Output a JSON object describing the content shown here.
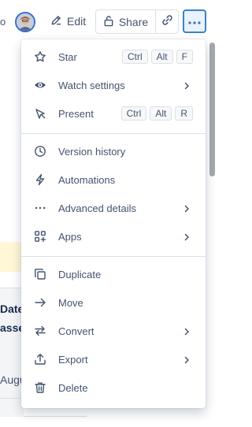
{
  "toolbar": {
    "cut_text": "o",
    "edit_label": "Edit",
    "share_label": "Share"
  },
  "background": {
    "table_header_line1": "Date",
    "table_header_line2": "asse",
    "table_cell": "Augu"
  },
  "menu": {
    "star": {
      "label": "Star",
      "keys": [
        "Ctrl",
        "Alt",
        "F"
      ]
    },
    "watch": {
      "label": "Watch settings"
    },
    "present": {
      "label": "Present",
      "keys": [
        "Ctrl",
        "Alt",
        "R"
      ]
    },
    "version_history": {
      "label": "Version history"
    },
    "automations": {
      "label": "Automations"
    },
    "advanced_details": {
      "label": "Advanced details"
    },
    "apps": {
      "label": "Apps"
    },
    "duplicate": {
      "label": "Duplicate"
    },
    "move": {
      "label": "Move"
    },
    "convert": {
      "label": "Convert"
    },
    "export": {
      "label": "Export"
    },
    "delete": {
      "label": "Delete"
    }
  },
  "colors": {
    "accent": "#3b82c4",
    "text": "#44546f",
    "highlight_bg": "#fff7d6"
  }
}
